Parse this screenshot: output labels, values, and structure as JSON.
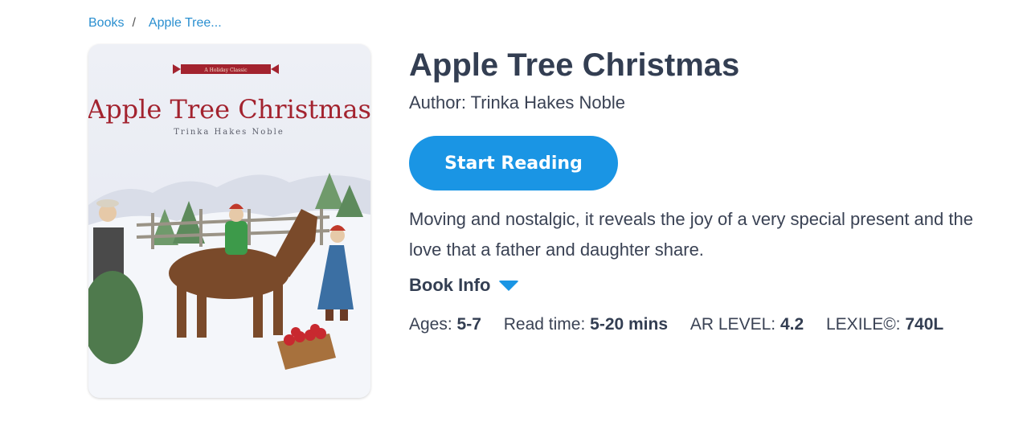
{
  "breadcrumb": {
    "items": [
      "Books",
      "Apple Tree..."
    ],
    "separator": "/"
  },
  "book": {
    "title": "Apple Tree Christmas",
    "author_label": "Author:",
    "author": "Trinka Hakes Noble",
    "description": "Moving and nostalgic, it reveals the joy of a very special present and the love that a father and daughter share.",
    "cover": {
      "banner": "A Holiday Classic",
      "title": "Apple Tree Christmas",
      "author": "Trinka Hakes Noble"
    }
  },
  "actions": {
    "start_reading": "Start Reading",
    "book_info": "Book Info"
  },
  "meta": {
    "ages_label": "Ages:",
    "ages": "5-7",
    "read_time_label": "Read time:",
    "read_time": "5-20 mins",
    "ar_level_label": "AR LEVEL:",
    "ar_level": "4.2",
    "lexile_label": "LEXILE©:",
    "lexile": "740L"
  },
  "colors": {
    "accent": "#1a95e4",
    "link": "#2a8fd0",
    "text": "#3a4254",
    "cover_title": "#a3232f"
  },
  "icons": [
    "caret-down-icon"
  ]
}
